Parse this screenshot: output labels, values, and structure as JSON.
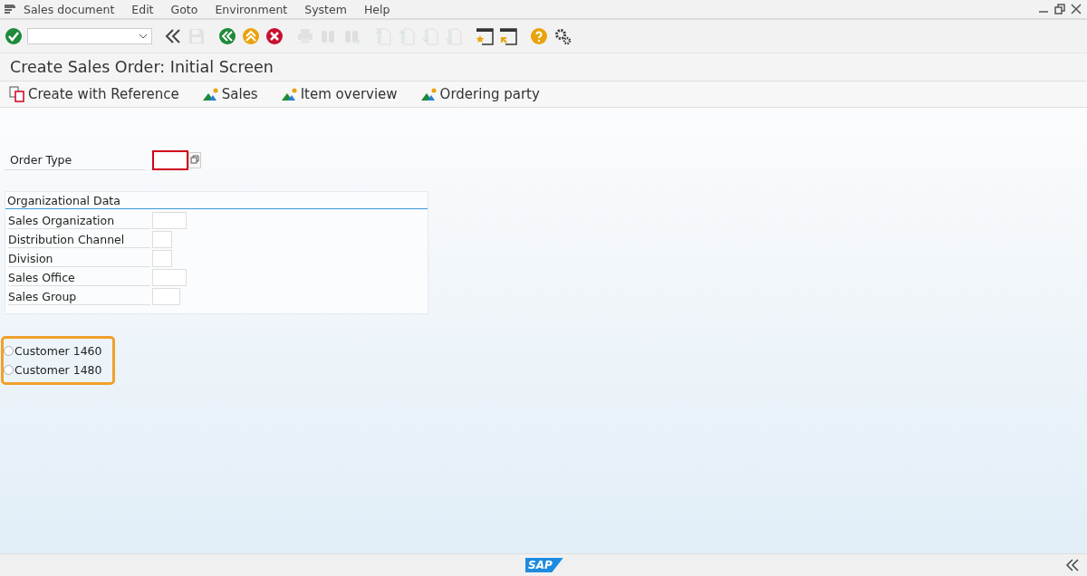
{
  "menu": [
    "Sales document",
    "Edit",
    "Goto",
    "Environment",
    "System",
    "Help"
  ],
  "toolbar": [
    {
      "kind": "enter",
      "disabled": false
    },
    {
      "kind": "command",
      "disabled": false
    },
    {
      "kind": "collapse",
      "disabled": false
    },
    {
      "kind": "save",
      "disabled": true
    },
    {
      "kind": "back",
      "disabled": false
    },
    {
      "kind": "exit",
      "disabled": false
    },
    {
      "kind": "cancel",
      "disabled": false
    },
    {
      "kind": "print",
      "disabled": true
    },
    {
      "kind": "find",
      "disabled": true
    },
    {
      "kind": "find-next",
      "disabled": true
    },
    {
      "kind": "first-page",
      "disabled": true
    },
    {
      "kind": "prev-page",
      "disabled": true
    },
    {
      "kind": "next-page",
      "disabled": true
    },
    {
      "kind": "last-page",
      "disabled": true
    },
    {
      "kind": "new-session",
      "disabled": false
    },
    {
      "kind": "shortcut",
      "disabled": false
    },
    {
      "kind": "help",
      "disabled": false
    },
    {
      "kind": "settings",
      "disabled": false
    }
  ],
  "title": "Create Sales Order: Initial Screen",
  "app_toolbar": [
    {
      "kind": "reference",
      "label": "Create with Reference"
    },
    {
      "kind": "overview",
      "label": "Sales"
    },
    {
      "kind": "overview",
      "label": "Item overview"
    },
    {
      "kind": "overview",
      "label": "Ordering party"
    }
  ],
  "order_type": {
    "label": "Order Type",
    "required": true
  },
  "org_data": {
    "title": "Organizational Data",
    "fields": [
      {
        "label": "Sales Organization"
      },
      {
        "label": "Distribution Channel"
      },
      {
        "label": "Division"
      },
      {
        "label": "Sales Office"
      },
      {
        "label": "Sales Group"
      }
    ]
  },
  "radios": [
    {
      "label": "Customer 1460",
      "selected": false
    },
    {
      "label": "Customer 1480",
      "selected": false
    }
  ],
  "highlight": true,
  "footer": {
    "logo": "SAP"
  }
}
